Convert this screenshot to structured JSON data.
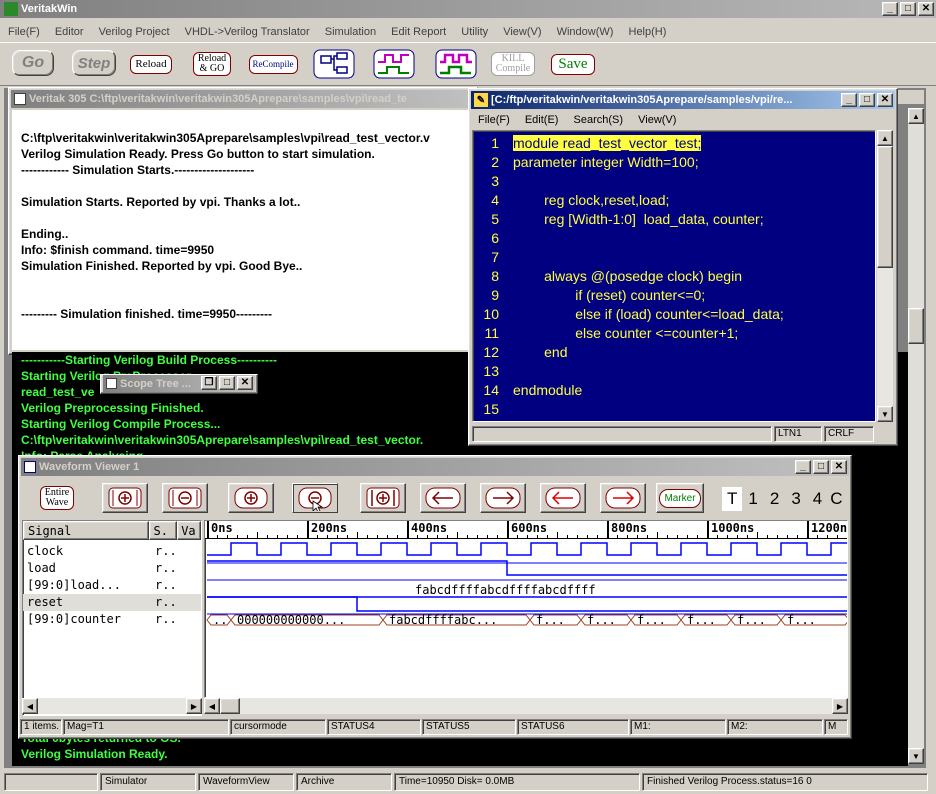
{
  "app": {
    "title": "VeritakWin"
  },
  "menu": [
    "File(F)",
    "Editor",
    "Verilog Project",
    "VHDL->Verilog Translator",
    "Simulation",
    "Edit Report",
    "Utility",
    "View(V)",
    "Window(W)",
    "Help(H)"
  ],
  "toolbar": {
    "go": "Go",
    "step": "Step",
    "reload": "Reload",
    "reload_go_1": "Reload",
    "reload_go_2": "& GO",
    "recompile": "ReCompile",
    "kill_1": "KILL",
    "kill_2": "Compile",
    "save": "Save"
  },
  "console_window": {
    "title": "Veritak 305 C:\\ftp\\veritakwin\\veritakwin305Aprepare\\samples\\vpi\\read_te",
    "lines": [
      "",
      "C:\\ftp\\veritakwin\\veritakwin305Aprepare\\samples\\vpi\\read_test_vector.v",
      "Verilog Simulation Ready. Press Go button to start simulation.",
      "------------ Simulation Starts.--------------------",
      "",
      "Simulation Starts. Reported by vpi. Thanks a lot..",
      "",
      "Ending..",
      "Info: $finish command. time=9950",
      "Simulation Finished. Reported by vpi. Good Bye..",
      "",
      "",
      "--------- Simulation finished. time=9950---------"
    ]
  },
  "build_log": {
    "lines": [
      "-----------Starting Verilog Build Process----------",
      "Starting Verilog PreProcessor",
      "read_test_ve",
      "Verilog Preprocessing Finished.",
      "Starting Verilog Compile Process...",
      "C:\\ftp\\veritakwin\\veritakwin305Aprepare\\samples\\vpi\\read_test_vector.",
      "Info: Parse Analysing"
    ],
    "bottom_lines": [
      "Total 0bytes returned to OS.",
      "Verilog Simulation Ready."
    ]
  },
  "scope_tree": {
    "title": "Scope Tree ..."
  },
  "editor": {
    "title": "[C:/ftp/veritakwin/veritakwin305Aprepare/samples/vpi/re...",
    "menu": [
      "File(F)",
      "Edit(E)",
      "Search(S)",
      "View(V)"
    ],
    "lines": [
      {
        "n": "1",
        "t": "module read_test_vector_test;"
      },
      {
        "n": "2",
        "t": "parameter integer Width=100;"
      },
      {
        "n": "3",
        "t": ""
      },
      {
        "n": "4",
        "t": "        reg clock,reset,load;"
      },
      {
        "n": "5",
        "t": "        reg [Width-1:0]  load_data, counter;"
      },
      {
        "n": "6",
        "t": ""
      },
      {
        "n": "7",
        "t": ""
      },
      {
        "n": "8",
        "t": "        always @(posedge clock) begin"
      },
      {
        "n": "9",
        "t": "                if (reset) counter<=0;"
      },
      {
        "n": "10",
        "t": "                else if (load) counter<=load_data;"
      },
      {
        "n": "11",
        "t": "                else counter <=counter+1;"
      },
      {
        "n": "12",
        "t": "        end"
      },
      {
        "n": "13",
        "t": ""
      },
      {
        "n": "14",
        "t": "endmodule"
      },
      {
        "n": "15",
        "t": ""
      }
    ],
    "status": {
      "pos": "LTN1",
      "eol": "CRLF"
    }
  },
  "waveform": {
    "title": "Waveform Viewer 1",
    "btn_entire_1": "Entire",
    "btn_entire_2": "Wave",
    "btn_marker": "Marker",
    "tlabels": [
      "T",
      "1",
      "2",
      "3",
      "4",
      "C"
    ],
    "headers": {
      "signal": "Signal",
      "s": "S.",
      "v": "Va"
    },
    "signals": [
      {
        "name": "clock",
        "s": "r.."
      },
      {
        "name": "load",
        "s": "r.."
      },
      {
        "name": "[99:0]load...",
        "s": "r.."
      },
      {
        "name": "reset",
        "s": "r.."
      },
      {
        "name": "[99:0]counter",
        "s": "r.."
      }
    ],
    "ticks": [
      "0ns",
      "200ns",
      "400ns",
      "600ns",
      "800ns",
      "1000ns",
      "1200n"
    ],
    "load_data_value": "fabcdffffabcdffffabcdffff",
    "counter_values": [
      "..",
      "000000000000...",
      "fabcdffffabc...",
      "f...",
      "f...",
      "f...",
      "f...",
      "f...",
      "f..."
    ],
    "status": [
      "1 items.",
      "Mag=T1",
      "cursormode",
      "STATUS4",
      "STATUS5",
      "STATUS6",
      "M1:",
      "M2:",
      "M"
    ]
  },
  "statusbar": [
    "Simulator",
    "WaveformView",
    "Archive",
    "Time=10950 Disk=  0.0MB",
    "Finished Verilog Process.status=16 0"
  ],
  "colors": {
    "editor_bg": "#000080",
    "code": "#ffff40",
    "console_text": "#40ff40",
    "wave": "#0000ff"
  }
}
